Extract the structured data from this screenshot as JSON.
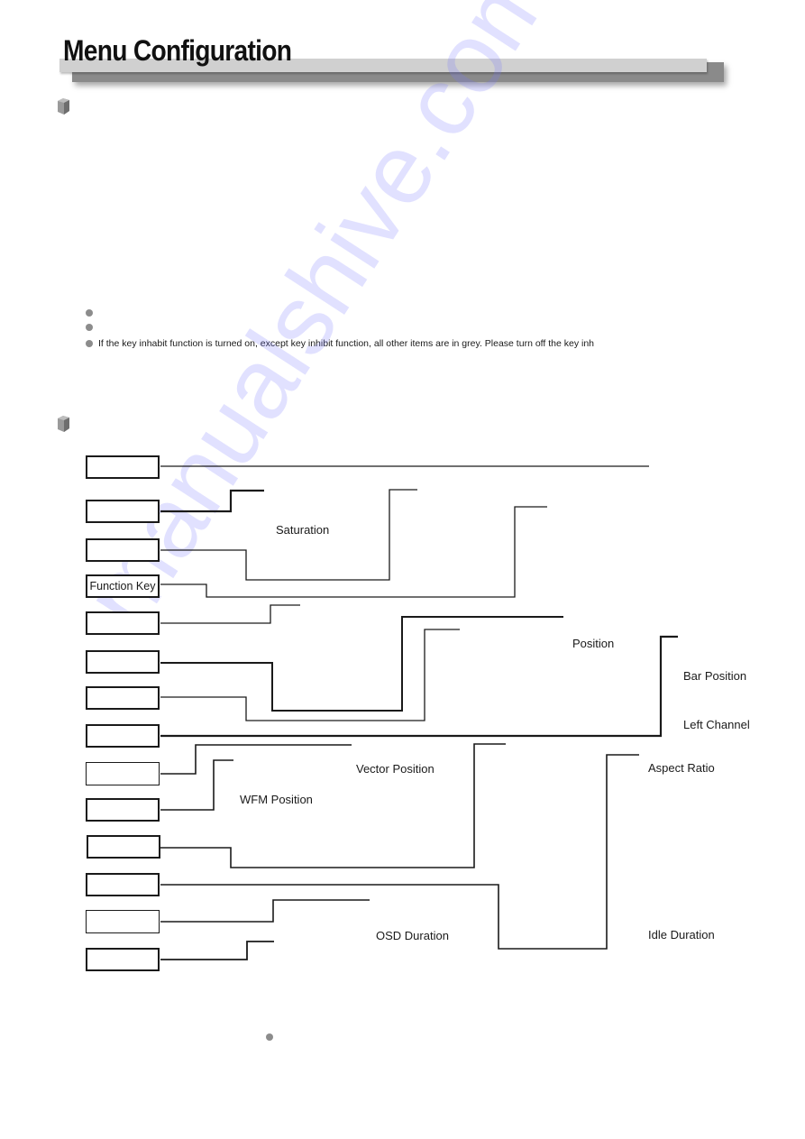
{
  "header": {
    "title": "Menu Configuration"
  },
  "section1": {
    "icon": "cube-icon",
    "bullets": [
      "",
      "",
      "If the key inhabit function is turned on, except key inhibit function, all other items are in grey. Please turn off the key inh"
    ]
  },
  "section2": {
    "icon": "cube-icon",
    "boxes": [
      "",
      "",
      "",
      "Function Key",
      "",
      "",
      "",
      "",
      "",
      "",
      "",
      "",
      "",
      ""
    ],
    "labels": {
      "saturation": "Saturation",
      "position": "Position",
      "bar_position": "Bar Position",
      "left_channel": "Left Channel",
      "vector_position": "Vector Position",
      "wfm_position": "WFM Position",
      "aspect_ratio": "Aspect Ratio",
      "osd_duration": "OSD Duration",
      "idle_duration": "Idle Duration"
    }
  },
  "footer": {
    "bullet": ""
  },
  "watermark": "manualshive.com"
}
